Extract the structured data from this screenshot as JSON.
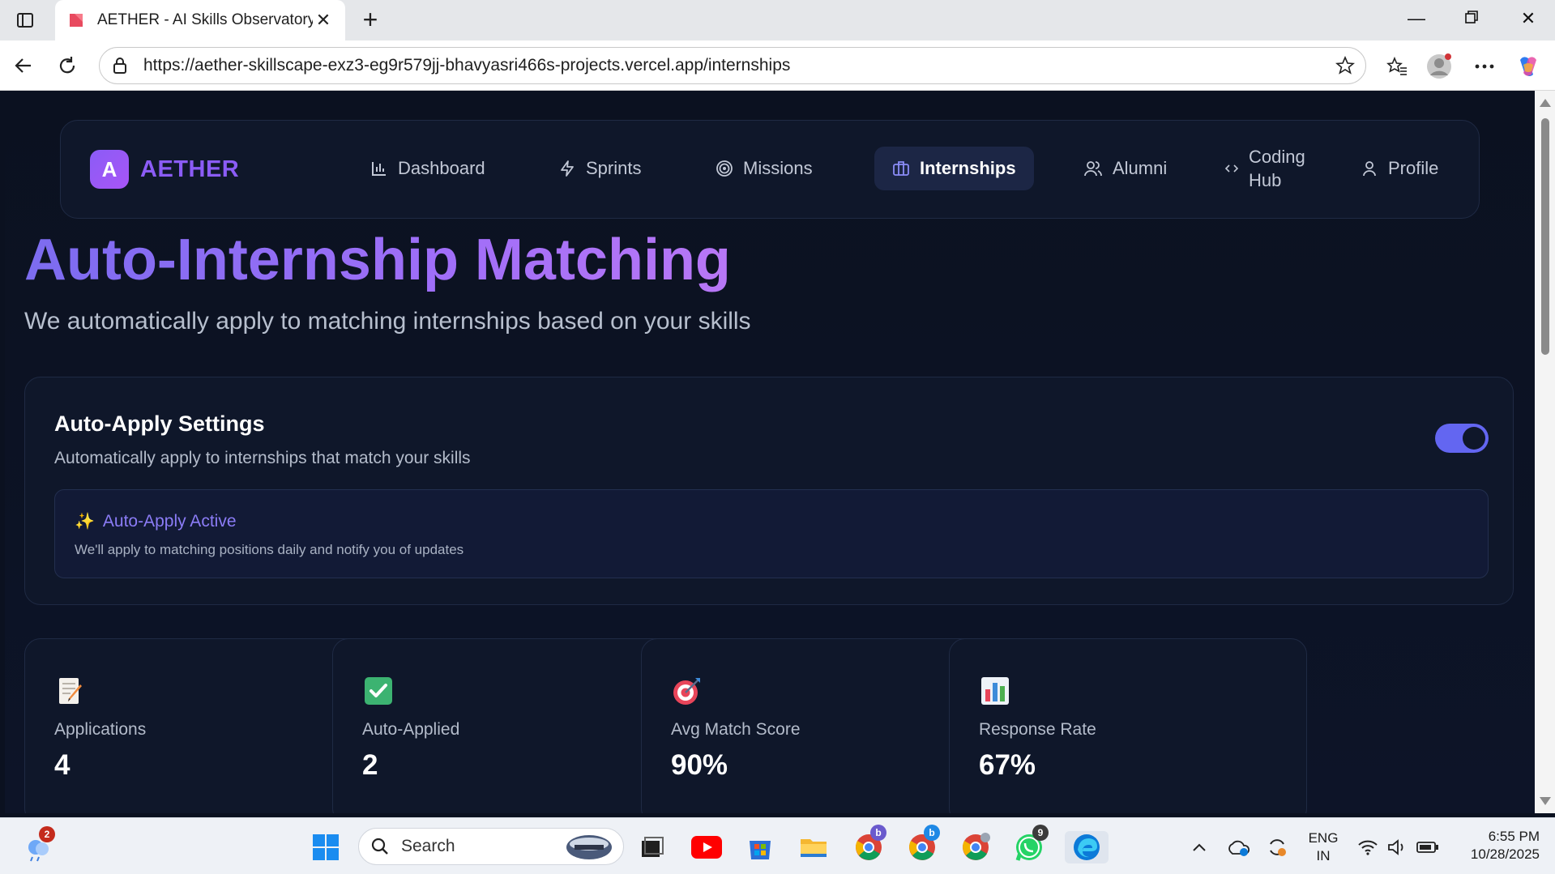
{
  "browser": {
    "tab_title": "AETHER - AI Skills Observatory",
    "url": "https://aether-skillscape-exz3-eg9r579jj-bhavyasri466s-projects.vercel.app/internships"
  },
  "app": {
    "logo_letter": "A",
    "logo_text": "AETHER",
    "nav": {
      "dashboard": "Dashboard",
      "sprints": "Sprints",
      "missions": "Missions",
      "internships": "Internships",
      "alumni": "Alumni",
      "coding_hub_line1": "Coding",
      "coding_hub_line2": "Hub",
      "profile": "Profile"
    },
    "active_nav": "Internships"
  },
  "hero": {
    "title": "Auto-Internship Matching",
    "subtitle": "We automatically apply to matching internships based on your skills"
  },
  "settings": {
    "title": "Auto-Apply Settings",
    "description": "Automatically apply to internships that match your skills",
    "toggle_on": true,
    "active_title": "Auto-Apply Active",
    "active_description": "We'll apply to matching positions daily and notify you of updates"
  },
  "stats": [
    {
      "icon": "memo-icon",
      "label": "Applications",
      "value": "4"
    },
    {
      "icon": "check-box-icon",
      "label": "Auto-Applied",
      "value": "2"
    },
    {
      "icon": "target-icon",
      "label": "Avg Match Score",
      "value": "90%"
    },
    {
      "icon": "bar-chart-icon",
      "label": "Response Rate",
      "value": "67%"
    }
  ],
  "taskbar": {
    "search_placeholder": "Search",
    "widgets_badge": "2",
    "whatsapp_badge": "9",
    "chrome_badge_1": "b",
    "chrome_badge_2": "b",
    "lang_line1": "ENG",
    "lang_line2": "IN",
    "time": "6:55 PM",
    "date": "10/28/2025"
  },
  "colors": {
    "accent": "#8b5cf6",
    "toggle": "#6366f1",
    "page_bg": "#0b1120",
    "card_bg": "#0f172a"
  }
}
